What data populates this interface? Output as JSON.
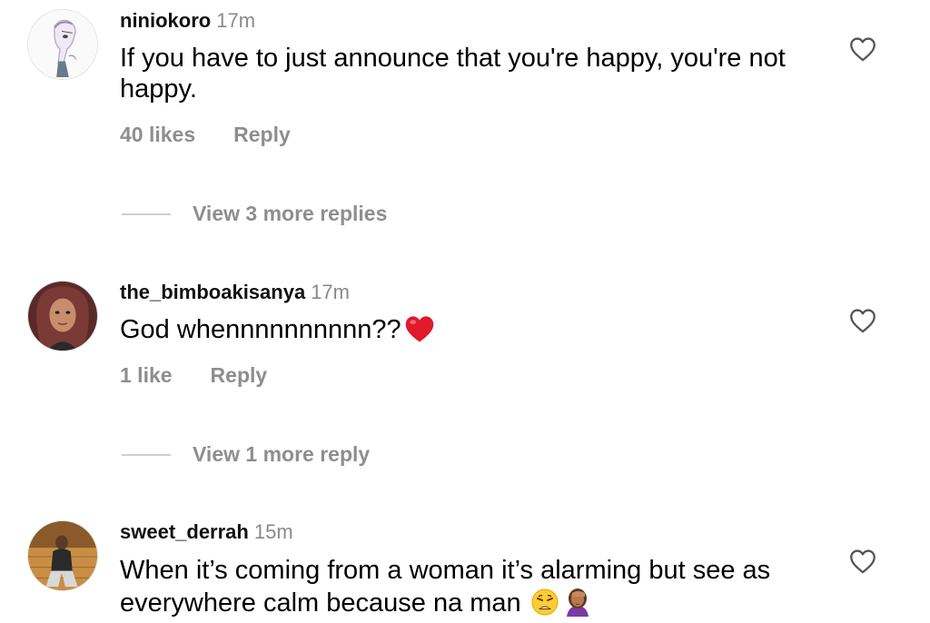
{
  "comments": [
    {
      "username": "niniokoro",
      "time": "17m",
      "text": "If you have to just announce that you're happy, you're not happy.",
      "likes": "40 likes",
      "reply": "Reply",
      "view_more": "View 3 more replies"
    },
    {
      "username": "the_bimboakisanya",
      "time": "17m",
      "text": "God whennnnnnnnnn??",
      "emoji": "heart-emoji",
      "likes": "1 like",
      "reply": "Reply",
      "view_more": "View 1 more reply"
    },
    {
      "username": "sweet_derrah",
      "time": "15m",
      "text": "When it’s coming from a woman it’s alarming but see as everywhere calm because na man",
      "emoji": [
        "weary-face-emoji",
        "facepalm-emoji"
      ]
    }
  ],
  "colors": {
    "muted": "#8e8e8e",
    "heart": "#e0192b"
  },
  "icons": {
    "like": "heart-outline-icon"
  }
}
